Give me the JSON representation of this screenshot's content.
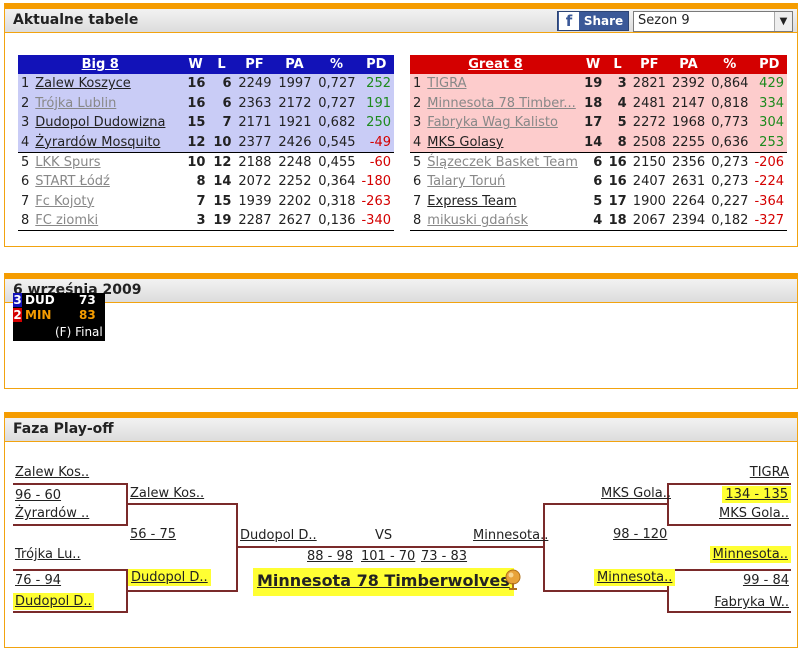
{
  "panel1": {
    "title": "Aktualne tabele",
    "share_label": "Share",
    "season": "Sezon 9",
    "columns": [
      "W",
      "L",
      "PF",
      "PA",
      "%",
      "PD"
    ],
    "left": {
      "name": "Big 8",
      "rows": [
        {
          "rank": "1",
          "team": "Zalew Koszyce",
          "w": "16",
          "l": "6",
          "pf": "2249",
          "pa": "1997",
          "pct": "0,727",
          "pd": "252"
        },
        {
          "rank": "2",
          "team": "Trójka Lublin",
          "w": "16",
          "l": "6",
          "pf": "2363",
          "pa": "2172",
          "pct": "0,727",
          "pd": "191"
        },
        {
          "rank": "3",
          "team": "Dudopol Dudowizna",
          "w": "15",
          "l": "7",
          "pf": "2171",
          "pa": "1921",
          "pct": "0,682",
          "pd": "250"
        },
        {
          "rank": "4",
          "team": "Żyrardów Mosquito",
          "w": "12",
          "l": "10",
          "pf": "2377",
          "pa": "2426",
          "pct": "0,545",
          "pd": "-49"
        },
        {
          "rank": "5",
          "team": "LKK Spurs",
          "w": "10",
          "l": "12",
          "pf": "2188",
          "pa": "2248",
          "pct": "0,455",
          "pd": "-60"
        },
        {
          "rank": "6",
          "team": "START Łódź",
          "w": "8",
          "l": "14",
          "pf": "2072",
          "pa": "2252",
          "pct": "0,364",
          "pd": "-180"
        },
        {
          "rank": "7",
          "team": "Fc Kojoty",
          "w": "7",
          "l": "15",
          "pf": "1939",
          "pa": "2202",
          "pct": "0,318",
          "pd": "-263"
        },
        {
          "rank": "8",
          "team": "FC ziomki",
          "w": "3",
          "l": "19",
          "pf": "2287",
          "pa": "2627",
          "pct": "0,136",
          "pd": "-340"
        }
      ]
    },
    "right": {
      "name": "Great 8",
      "rows": [
        {
          "rank": "1",
          "team": "TIGRA",
          "w": "19",
          "l": "3",
          "pf": "2821",
          "pa": "2392",
          "pct": "0,864",
          "pd": "429"
        },
        {
          "rank": "2",
          "team": "Minnesota 78 Timber...",
          "w": "18",
          "l": "4",
          "pf": "2481",
          "pa": "2147",
          "pct": "0,818",
          "pd": "334"
        },
        {
          "rank": "3",
          "team": "Fabryka Wag Kalisto",
          "w": "17",
          "l": "5",
          "pf": "2272",
          "pa": "1968",
          "pct": "0,773",
          "pd": "304"
        },
        {
          "rank": "4",
          "team": "MKS Golasy",
          "w": "14",
          "l": "8",
          "pf": "2508",
          "pa": "2255",
          "pct": "0,636",
          "pd": "253"
        },
        {
          "rank": "5",
          "team": "Ślązeczek Basket Team",
          "w": "6",
          "l": "16",
          "pf": "2150",
          "pa": "2356",
          "pct": "0,273",
          "pd": "-206"
        },
        {
          "rank": "6",
          "team": "Talary Toruń",
          "w": "6",
          "l": "16",
          "pf": "2407",
          "pa": "2631",
          "pct": "0,273",
          "pd": "-224"
        },
        {
          "rank": "7",
          "team": "Express Team",
          "w": "5",
          "l": "17",
          "pf": "1900",
          "pa": "2264",
          "pct": "0,227",
          "pd": "-364"
        },
        {
          "rank": "8",
          "team": "mikuski gdańsk",
          "w": "4",
          "l": "18",
          "pf": "2067",
          "pa": "2394",
          "pct": "0,182",
          "pd": "-327"
        }
      ]
    }
  },
  "panel2": {
    "title": "6 września 2009",
    "game": {
      "home_seed": "3",
      "home_team": "DUD",
      "home_pts": "73",
      "away_seed": "2",
      "away_team": "MIN",
      "away_pts": "83",
      "status": "(F) Final"
    }
  },
  "panel3": {
    "title": "Faza Play-off",
    "left": {
      "r1a_top": "Zalew Kos..",
      "r1a_score": "96 - 60",
      "r1a_bot": "Żyrardów ..",
      "r1b_top": "Trójka Lu..",
      "r1b_score": "76 - 94",
      "r1b_bot": "Dudopol D..",
      "r2_top": "Zalew Kos..",
      "r2_score": "56 - 75",
      "r2_bot": "Dudopol D..",
      "final_team": "Dudopol D.."
    },
    "right": {
      "r1a_top": "TIGRA",
      "r1a_score": "134 - 135",
      "r1a_bot": "MKS Gola..",
      "r1b_top": "Minnesota..",
      "r1b_score": "99 - 84",
      "r1b_bot": "Fabryka W..",
      "r2_top": "MKS Gola..",
      "r2_score": "98 - 120",
      "r2_bot": "Minnesota..",
      "final_team": "Minnesota.."
    },
    "vs": "VS",
    "final_scores": [
      "88 - 98",
      "101 - 70",
      "73 - 83"
    ],
    "champion": "Minnesota 78 Timberwolves"
  }
}
